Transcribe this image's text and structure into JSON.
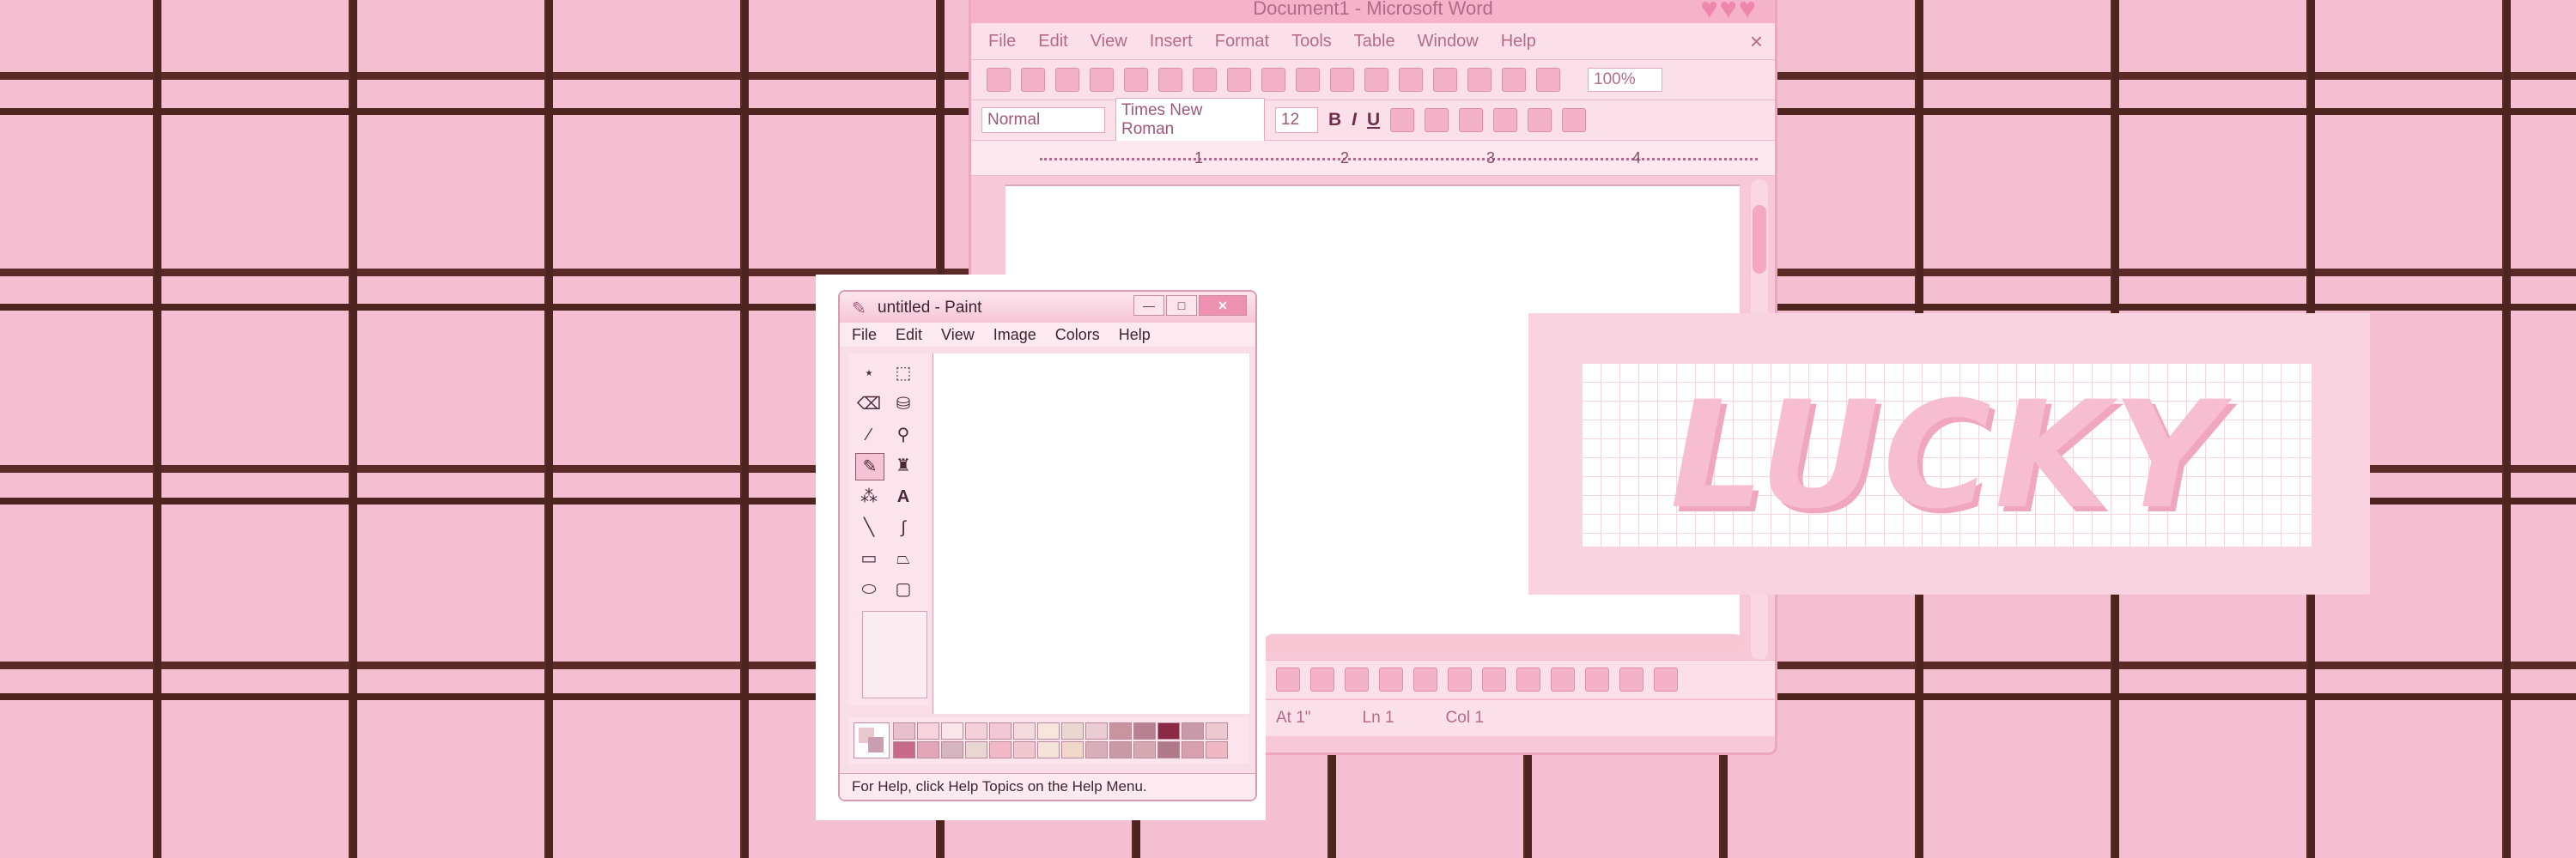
{
  "word": {
    "title": "Document1 - Microsoft Word",
    "menu": [
      "File",
      "Edit",
      "View",
      "Insert",
      "Format",
      "Tools",
      "Table",
      "Window",
      "Help"
    ],
    "close": "×",
    "zoom": "100%",
    "style": "Normal",
    "font": "Times New Roman",
    "size": "12",
    "bold": "B",
    "italic": "I",
    "underline": "U",
    "ruler": [
      "1",
      "2",
      "3",
      "4"
    ],
    "status": {
      "at": "At 1\"",
      "ln": "Ln 1",
      "col": "Col 1"
    }
  },
  "paint": {
    "title": "untitled - Paint",
    "menu": [
      "File",
      "Edit",
      "View",
      "Image",
      "Colors",
      "Help"
    ],
    "status": "For Help, click Help Topics on the Help Menu.",
    "palette_colors": [
      "#e9bfcc",
      "#f7d4dd",
      "#f8e6ea",
      "#f4d0d9",
      "#f3c7d3",
      "#f4dbe0",
      "#f7e6dc",
      "#e9d8cf",
      "#e9cdd2",
      "#c8959f",
      "#b88090",
      "#8a2a44",
      "#c99aa8",
      "#efc9d1",
      "#c86b88",
      "#e3a6b8",
      "#d6b6be",
      "#e8d6d0",
      "#f2b8c6",
      "#f1c8d0",
      "#f3e3da",
      "#f1d7c8",
      "#d8aeb8",
      "#c79aa6",
      "#d5a8b2",
      "#b07a88",
      "#d8a0ae",
      "#f0b8c4"
    ]
  },
  "lucky": {
    "text": "LUCKY"
  },
  "colors": {
    "background": "#f4bfd0",
    "grid_line": "#4e2420",
    "accent": "#ef86ab"
  }
}
